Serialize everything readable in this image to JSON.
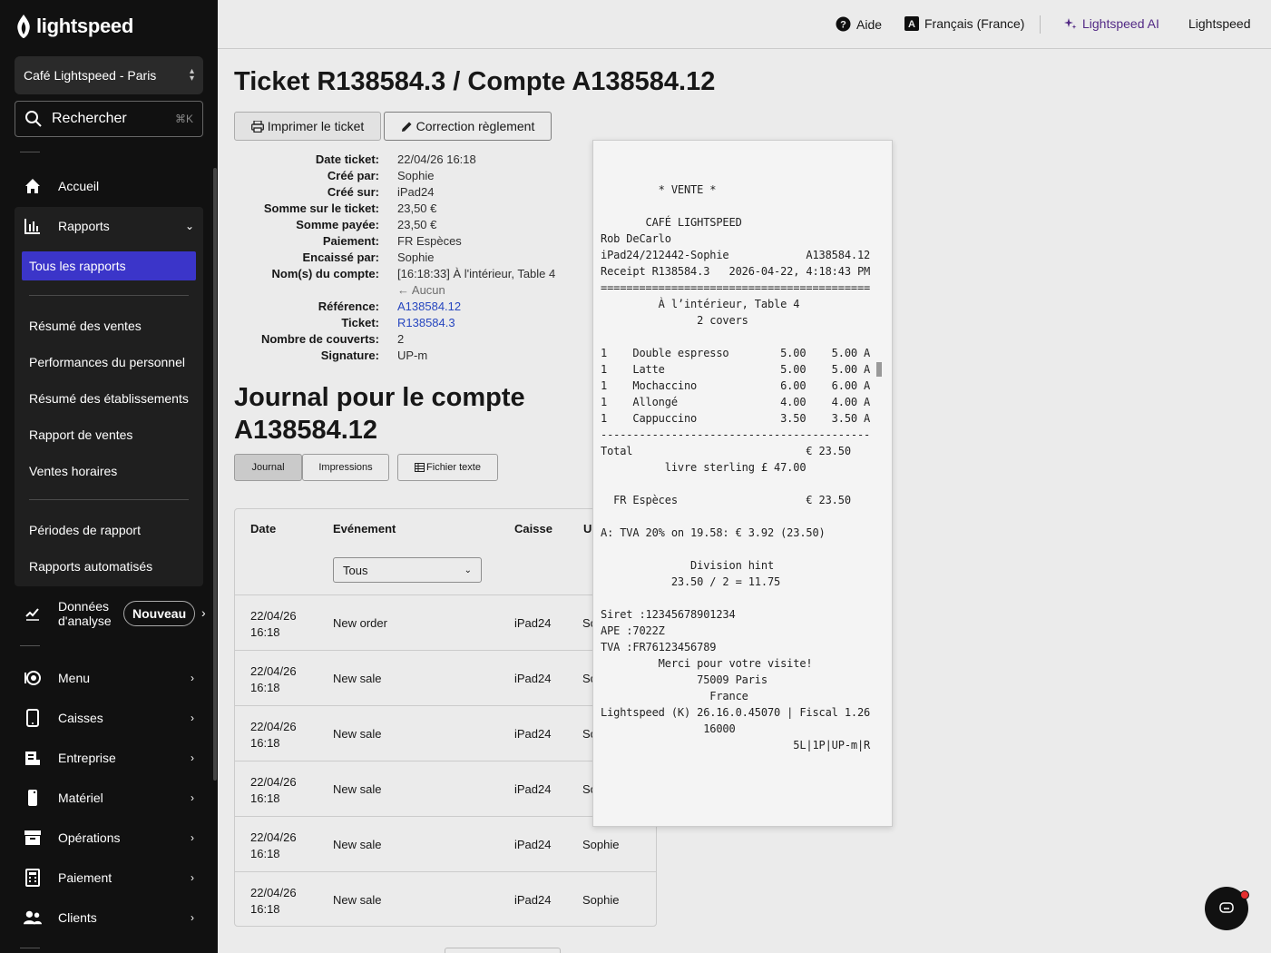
{
  "app": {
    "logo_text": "lightspeed"
  },
  "sidebar": {
    "store": "Café Lightspeed - Paris",
    "search_label": "Rechercher",
    "search_shortcut": "⌘K",
    "items": {
      "accueil": "Accueil",
      "rapports": "Rapports",
      "donnees": "Données d'analyse",
      "donnees_badge": "Nouveau",
      "menu": "Menu",
      "caisses": "Caisses",
      "entreprise": "Entreprise",
      "materiel": "Matériel",
      "operations": "Opérations",
      "paiement": "Paiement",
      "clients": "Clients"
    },
    "rapports_sub": {
      "active": "Tous les rapports",
      "group1": [
        "Résumé des ventes",
        "Performances du personnel",
        "Résumé des établissements",
        "Rapport de ventes",
        "Ventes horaires"
      ],
      "group2": [
        "Périodes de rapport",
        "Rapports automatisés"
      ]
    }
  },
  "topbar": {
    "help": "Aide",
    "language": "Français (France)",
    "ai": "Lightspeed AI",
    "account": "Lightspeed"
  },
  "page": {
    "title": "Ticket R138584.3 / Compte A138584.12",
    "print_button": "Imprimer le ticket",
    "correction_button": "Correction règlement",
    "info": [
      {
        "label": "Date ticket:",
        "value": "22/04/26 16:18"
      },
      {
        "label": "Créé par:",
        "value": "Sophie"
      },
      {
        "label": "Créé sur:",
        "value": "iPad24"
      },
      {
        "label": "Somme sur le ticket:",
        "value": "23,50 €"
      },
      {
        "label": "Somme payée:",
        "value": "23,50 €"
      },
      {
        "label": "Paiement:",
        "value": "FR Espèces"
      },
      {
        "label": "Encaissé par:",
        "value": "Sophie"
      },
      {
        "label": "Nom(s) du compte:",
        "value": "[16:18:33] À l'intérieur, Table 4"
      },
      {
        "label": "",
        "value": "← Aucun"
      },
      {
        "label": "Référence:",
        "value": "A138584.12"
      },
      {
        "label": "Ticket:",
        "value": "R138584.3"
      },
      {
        "label": "Nombre de couverts:",
        "value": "2"
      },
      {
        "label": "Signature:",
        "value": "UP-m"
      }
    ],
    "journal_title": "Journal pour le compte A138584.12",
    "tabs": {
      "journal": "Journal",
      "impressions": "Impressions",
      "fichier": "Fichier texte"
    }
  },
  "table": {
    "headers": {
      "date": "Date",
      "event": "Evénement",
      "register": "Caisse",
      "user": "U"
    },
    "filter": "Tous",
    "rows": [
      {
        "date1": "22/04/26",
        "date2": "16:18",
        "event": "New order",
        "register": "iPad24",
        "user": "Sc"
      },
      {
        "date1": "22/04/26",
        "date2": "16:18",
        "event": "New sale",
        "register": "iPad24",
        "user": "Sc"
      },
      {
        "date1": "22/04/26",
        "date2": "16:18",
        "event": "New sale",
        "register": "iPad24",
        "user": "Sc"
      },
      {
        "date1": "22/04/26",
        "date2": "16:18",
        "event": "New sale",
        "register": "iPad24",
        "user": "Sc"
      },
      {
        "date1": "22/04/26",
        "date2": "16:18",
        "event": "New sale",
        "register": "iPad24",
        "user": "Sophie"
      },
      {
        "date1": "22/04/26",
        "date2": "16:18",
        "event": "New sale",
        "register": "iPad24",
        "user": "Sophie"
      }
    ]
  },
  "receipt": {
    "text": "         * VENTE *\n\n       CAFÉ LIGHTSPEED\nRob DeCarlo\niPad24/212442-Sophie            A138584.12\nReceipt R138584.3   2026-04-22, 4:18:43 PM\n==========================================\n         À l’intérieur, Table 4\n               2 covers\n\n1    Double espresso        5.00    5.00 A\n1    Latte                  5.00    5.00 A\n1    Mochaccino             6.00    6.00 A\n1    Allongé                4.00    4.00 A\n1    Cappuccino             3.50    3.50 A\n------------------------------------------\nTotal                           € 23.50\n          livre sterling £ 47.00\n\n  FR Espèces                    € 23.50\n\nA: TVA 20% on 19.58: € 3.92 (23.50)\n\n              Division hint\n           23.50 / 2 = 11.75\n\nSiret :12345678901234\nAPE :7022Z\nTVA :FR76123456789\n         Merci pour votre visite!\n               75009 Paris\n                 France\nLightspeed (K) 26.16.0.45070 | Fiscal 1.26\n                16000\n                              5L|1P|UP-m|R"
  }
}
